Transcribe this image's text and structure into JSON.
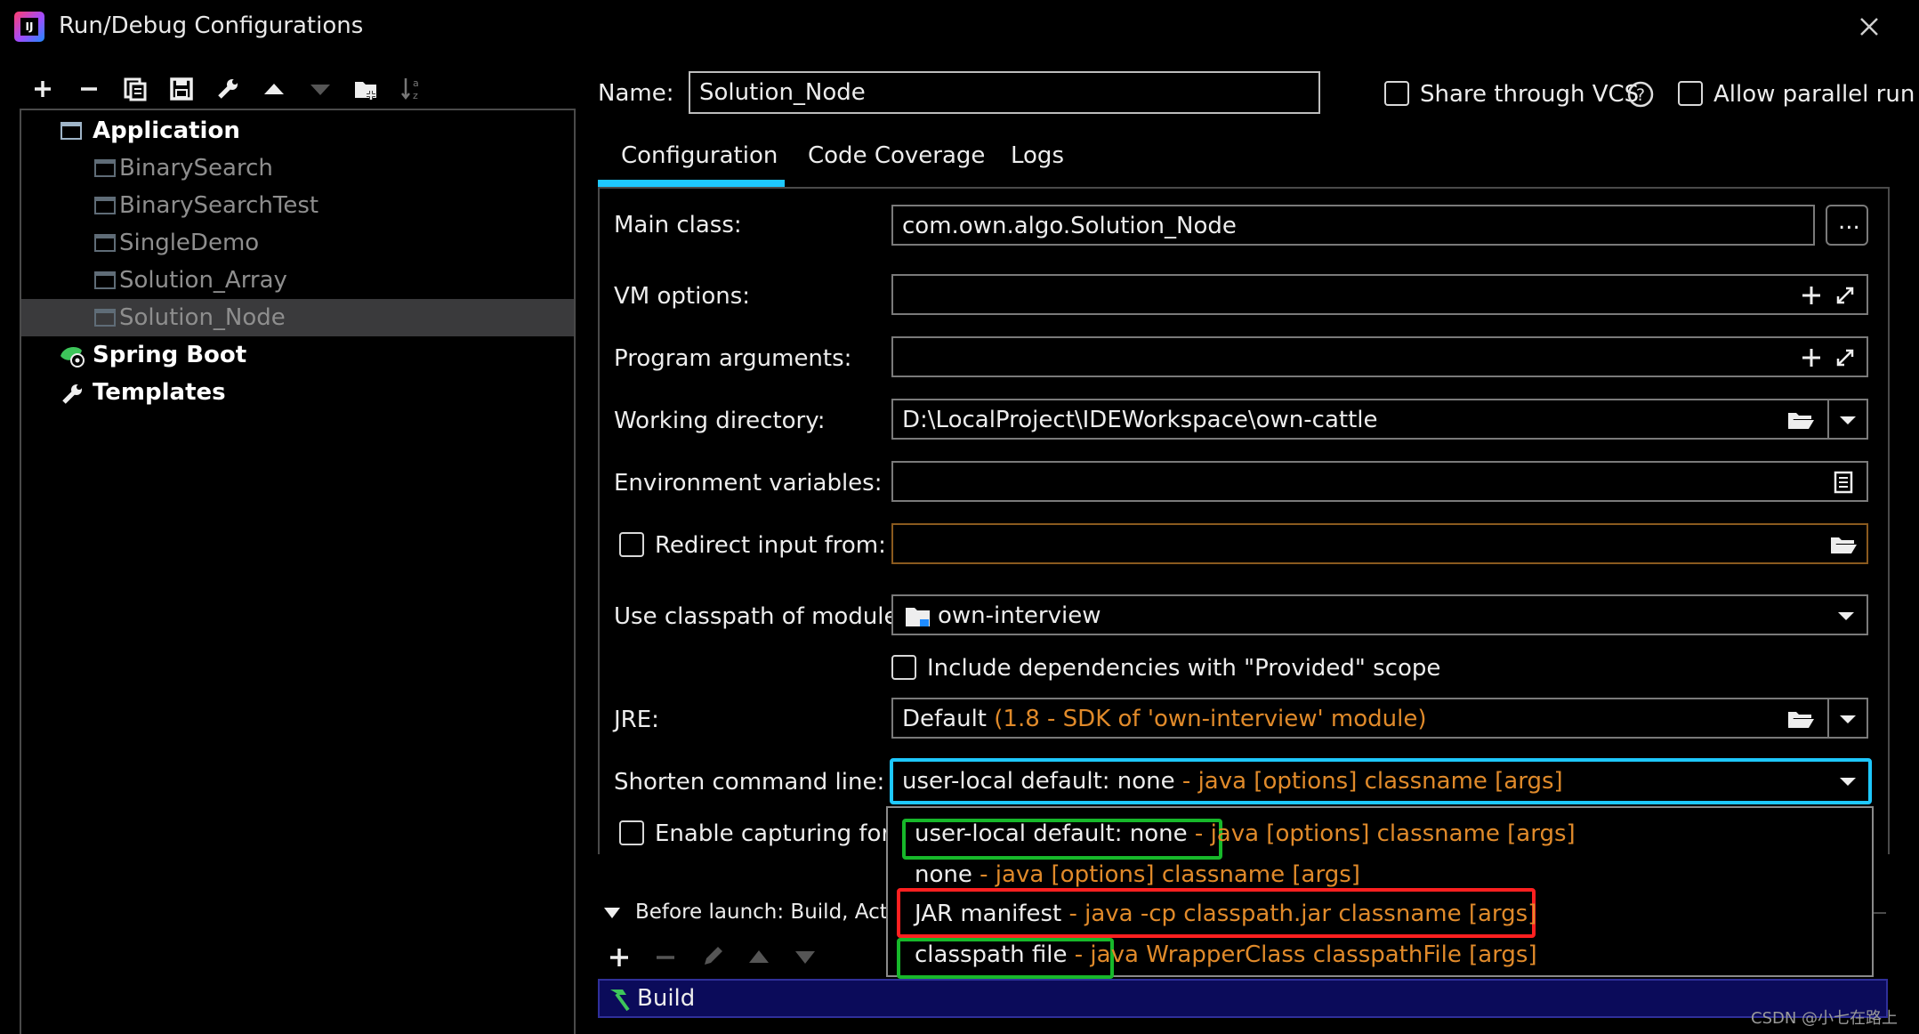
{
  "window": {
    "title": "Run/Debug Configurations",
    "logo_text": "IJ"
  },
  "toolbar": {
    "icons": [
      "add-icon",
      "remove-icon",
      "copy-icon",
      "save-icon",
      "wrench-icon",
      "move-up-icon",
      "move-down-icon",
      "new-folder-icon",
      "sort-icon"
    ]
  },
  "tree": {
    "application": "Application",
    "items": [
      "BinarySearch",
      "BinarySearchTest",
      "SingleDemo",
      "Solution_Array",
      "Solution_Node"
    ],
    "spring_boot": "Spring Boot",
    "templates": "Templates"
  },
  "header": {
    "name_label": "Name:",
    "name_value": "Solution_Node",
    "share_vcs": "Share through VCS",
    "allow_parallel": "Allow parallel run"
  },
  "tabs": [
    "Configuration",
    "Code Coverage",
    "Logs"
  ],
  "form": {
    "main_class_label": "Main class:",
    "main_class_value": "com.own.algo.Solution_Node",
    "browse_label": "...",
    "vm_options_label": "VM options:",
    "program_args_label": "Program arguments:",
    "working_dir_label": "Working directory:",
    "working_dir_value": "D:\\LocalProject\\IDEWorkspace\\own-cattle",
    "env_vars_label": "Environment variables:",
    "redirect_label": "Redirect input from:",
    "module_label": "Use classpath of module:",
    "module_value": "own-interview",
    "include_deps_label": "Include dependencies with \"Provided\" scope",
    "jre_label": "JRE:",
    "jre_value_main": "Default",
    "jre_value_detail": "(1.8 - SDK of 'own-interview' module)",
    "shorten_label": "Shorten command line:",
    "shorten_value_main": "user-local default: none",
    "shorten_value_detail": "- java [options] classname [args]",
    "capture_label": "Enable capturing form"
  },
  "dropdown_options": [
    {
      "main": "user-local default: none",
      "detail": "- java [options] classname [args]"
    },
    {
      "main": "none",
      "detail": "- java [options] classname [args]"
    },
    {
      "main": "JAR manifest",
      "detail": "- java -cp classpath.jar classname [args]"
    },
    {
      "main": "classpath file",
      "detail": "- java WrapperClass classpathFile [args]"
    }
  ],
  "before_launch": {
    "label": "Before launch: Build, Activa",
    "build": "Build"
  },
  "colors": {
    "accent_cyan": "#1ec8ff",
    "highlight_green": "#17b82a",
    "highlight_red": "#ff2020",
    "orange": "#e08a2a",
    "build_bg": "#0b0b5a"
  },
  "watermark": "CSDN @小七在路上"
}
